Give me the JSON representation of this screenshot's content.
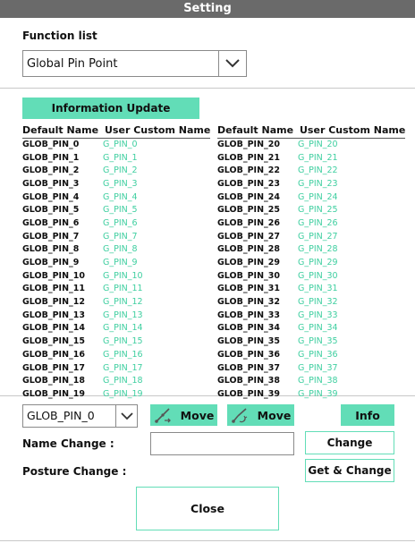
{
  "window": {
    "title": "Setting"
  },
  "function_list": {
    "label": "Function list",
    "selected": "Global Pin Point"
  },
  "info_update_label": "Information Update",
  "table_headers": {
    "default": "Default Name",
    "custom": "User Custom Name"
  },
  "left_rows": [
    {
      "default": "GLOB_PIN_0",
      "custom": "G_PIN_0"
    },
    {
      "default": "GLOB_PIN_1",
      "custom": "G_PIN_1"
    },
    {
      "default": "GLOB_PIN_2",
      "custom": "G_PIN_2"
    },
    {
      "default": "GLOB_PIN_3",
      "custom": "G_PIN_3"
    },
    {
      "default": "GLOB_PIN_4",
      "custom": "G_PIN_4"
    },
    {
      "default": "GLOB_PIN_5",
      "custom": "G_PIN_5"
    },
    {
      "default": "GLOB_PIN_6",
      "custom": "G_PIN_6"
    },
    {
      "default": "GLOB_PIN_7",
      "custom": "G_PIN_7"
    },
    {
      "default": "GLOB_PIN_8",
      "custom": "G_PIN_8"
    },
    {
      "default": "GLOB_PIN_9",
      "custom": "G_PIN_9"
    },
    {
      "default": "GLOB_PIN_10",
      "custom": "G_PIN_10"
    },
    {
      "default": "GLOB_PIN_11",
      "custom": "G_PIN_11"
    },
    {
      "default": "GLOB_PIN_12",
      "custom": "G_PIN_12"
    },
    {
      "default": "GLOB_PIN_13",
      "custom": "G_PIN_13"
    },
    {
      "default": "GLOB_PIN_14",
      "custom": "G_PIN_14"
    },
    {
      "default": "GLOB_PIN_15",
      "custom": "G_PIN_15"
    },
    {
      "default": "GLOB_PIN_16",
      "custom": "G_PIN_16"
    },
    {
      "default": "GLOB_PIN_17",
      "custom": "G_PIN_17"
    },
    {
      "default": "GLOB_PIN_18",
      "custom": "G_PIN_18"
    },
    {
      "default": "GLOB_PIN_19",
      "custom": "G_PIN_19"
    }
  ],
  "right_rows": [
    {
      "default": "GLOB_PIN_20",
      "custom": "G_PIN_20"
    },
    {
      "default": "GLOB_PIN_21",
      "custom": "G_PIN_21"
    },
    {
      "default": "GLOB_PIN_22",
      "custom": "G_PIN_22"
    },
    {
      "default": "GLOB_PIN_23",
      "custom": "G_PIN_23"
    },
    {
      "default": "GLOB_PIN_24",
      "custom": "G_PIN_24"
    },
    {
      "default": "GLOB_PIN_25",
      "custom": "G_PIN_25"
    },
    {
      "default": "GLOB_PIN_26",
      "custom": "G_PIN_26"
    },
    {
      "default": "GLOB_PIN_27",
      "custom": "G_PIN_27"
    },
    {
      "default": "GLOB_PIN_28",
      "custom": "G_PIN_28"
    },
    {
      "default": "GLOB_PIN_29",
      "custom": "G_PIN_29"
    },
    {
      "default": "GLOB_PIN_30",
      "custom": "G_PIN_30"
    },
    {
      "default": "GLOB_PIN_31",
      "custom": "G_PIN_31"
    },
    {
      "default": "GLOB_PIN_32",
      "custom": "G_PIN_32"
    },
    {
      "default": "GLOB_PIN_33",
      "custom": "G_PIN_33"
    },
    {
      "default": "GLOB_PIN_34",
      "custom": "G_PIN_34"
    },
    {
      "default": "GLOB_PIN_35",
      "custom": "G_PIN_35"
    },
    {
      "default": "GLOB_PIN_36",
      "custom": "G_PIN_36"
    },
    {
      "default": "GLOB_PIN_37",
      "custom": "G_PIN_37"
    },
    {
      "default": "GLOB_PIN_38",
      "custom": "G_PIN_38"
    },
    {
      "default": "GLOB_PIN_39",
      "custom": "G_PIN_39"
    }
  ],
  "pin_select": {
    "selected": "GLOB_PIN_0"
  },
  "buttons": {
    "move1": "Move",
    "move2": "Move",
    "info": "Info",
    "change": "Change",
    "get_change": "Get & Change",
    "close": "Close"
  },
  "labels": {
    "name_change": "Name Change :",
    "posture_change": "Posture Change :"
  },
  "name_input": {
    "value": ""
  },
  "icons": {
    "move1": "robot-arm-move-icon",
    "move2": "robot-arm-joint-move-icon",
    "dropdown": "chevron-down-icon"
  },
  "colors": {
    "accent": "#62ddb7",
    "custom_name_text": "#3fcfa0",
    "titlebar": "#6a6a6a"
  }
}
